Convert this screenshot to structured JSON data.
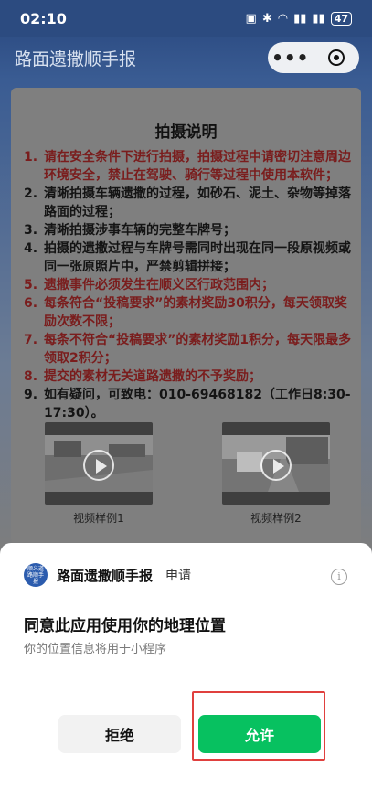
{
  "status_bar": {
    "time": "02:10",
    "battery": "47"
  },
  "header": {
    "title": "路面遗撒顺手报",
    "more_glyph": "•••"
  },
  "card": {
    "title": "拍摄说明",
    "items": [
      {
        "num": "1.",
        "text": "请在安全条件下进行拍摄，拍摄过程中请密切注意周边环境安全，禁止在驾驶、骑行等过程中使用本软件；",
        "color": "#7a1d1d"
      },
      {
        "num": "2.",
        "text": "清晰拍摄车辆遗撒的过程，如砂石、泥土、杂物等掉落路面的过程；",
        "color": "#141414"
      },
      {
        "num": "3.",
        "text": "清晰拍摄涉事车辆的完整车牌号；",
        "color": "#141414"
      },
      {
        "num": "4.",
        "text": "拍摄的遗撒过程与车牌号需同时出现在同一段原视频或同一张原照片中，严禁剪辑拼接；",
        "color": "#141414"
      },
      {
        "num": "5.",
        "text": "遗撒事件必须发生在顺义区行政范围内；",
        "color": "#7a1d1d"
      },
      {
        "num": "6.",
        "text": "每条符合“投稿要求”的素材奖励30积分，每天领取奖励次数不限；",
        "color": "#7a1d1d"
      },
      {
        "num": "7.",
        "text": "每条不符合“投稿要求”的素材奖励1积分，每天限最多领取2积分；",
        "color": "#7a1d1d"
      },
      {
        "num": "8.",
        "text": "提交的素材无关道路遗撒的不予奖励；",
        "color": "#7a1d1d"
      },
      {
        "num": "9.",
        "text": "如有疑问，可致电：010-69468182（工作日8:30-17:30）。",
        "color": "#141414"
      }
    ],
    "videos": [
      {
        "label": "视频样例1"
      },
      {
        "label": "视频样例2"
      }
    ]
  },
  "sheet": {
    "logo_text": "顺义道路顺手报",
    "app_name": "路面遗撒顺手报",
    "request": "申请",
    "title": "同意此应用使用你的地理位置",
    "description": "你的位置信息将用于小程序",
    "deny_label": "拒绝",
    "allow_label": "允许",
    "info_glyph": "i"
  },
  "colors": {
    "allow": "#07c160",
    "highlight": "#e0403e",
    "warning_text": "#7a1d1d"
  }
}
